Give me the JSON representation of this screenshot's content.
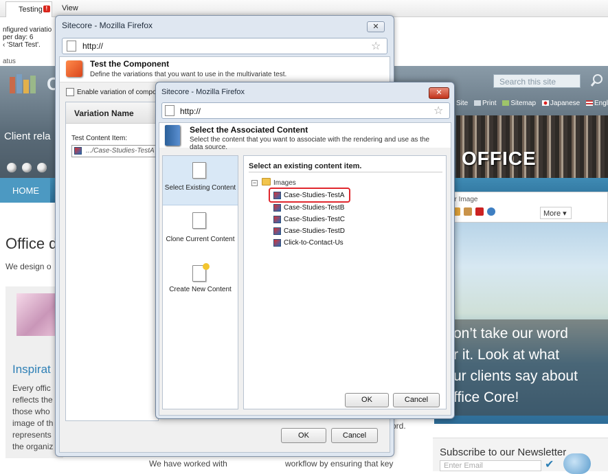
{
  "browser": {
    "tab_label": "Testing",
    "tab_badge": "!",
    "view_menu": "View"
  },
  "background_page": {
    "info_lines": [
      "nfigured variatio",
      "per day: 6",
      "‹ 'Start Test'."
    ],
    "status_label": "atus",
    "logo_text": "Of",
    "client_rel": "Client rela",
    "search_placeholder": "Search this site",
    "top_links": [
      "Site",
      "Print",
      "Sitemap",
      "Japanese",
      "Englis"
    ],
    "office_banner": "OFFICE",
    "nav_home": "HOME",
    "heading": "Office d",
    "design_line": "We design o",
    "inspiration": "Inspirat",
    "body_lines": [
      "Every offic",
      "reflects the",
      "those who",
      "image of th",
      "represents",
      "the organiz"
    ],
    "bottom_text_a": "We have worked with",
    "bottom_text_b": "workflow by ensuring that key",
    "ord_text": "ord.",
    "toolbar_label": "ar Image",
    "more_label": "More ▾",
    "quote_lines": [
      "on’t take our word",
      "r it. Look at what",
      "ur clients say about",
      "ffice Core!"
    ],
    "newsletter_title": "Subscribe to our Newsletter",
    "email_placeholder": "Enter Email"
  },
  "dialog_component": {
    "window_title": "Sitecore - Mozilla Firefox",
    "url": "http://",
    "title": "Test the Component",
    "subtitle": "Define the variations that you want to use in the multivariate test.",
    "enable_label": "Enable variation of compo",
    "variation_header": "Variation Name",
    "test_content_label": "Test Content Item:",
    "test_content_value": ".../Case-Studies-TestA",
    "ok": "OK",
    "cancel": "Cancel"
  },
  "dialog_content": {
    "window_title": "Sitecore - Mozilla Firefox",
    "url": "http://",
    "title": "Select the Associated Content",
    "subtitle": "Select the content that you want to associate with the rendering and use as the data source.",
    "options": [
      {
        "label": "Select Existing Content",
        "selected": true
      },
      {
        "label": "Clone Current Content",
        "selected": false
      },
      {
        "label": "Create New Content",
        "selected": false
      }
    ],
    "tree_title": "Select an existing content item.",
    "tree_root": "Images",
    "tree_items": [
      "Case-Studies-TestA",
      "Case-Studies-TestB",
      "Case-Studies-TestC",
      "Case-Studies-TestD",
      "Click-to-Contact-Us"
    ],
    "selected_item": "Case-Studies-TestA",
    "ok": "OK",
    "cancel": "Cancel"
  },
  "colors": {
    "accent_blue": "#2d7fb5",
    "highlight_red": "#e0262c",
    "dialog_frame": "#dfe7f1"
  }
}
